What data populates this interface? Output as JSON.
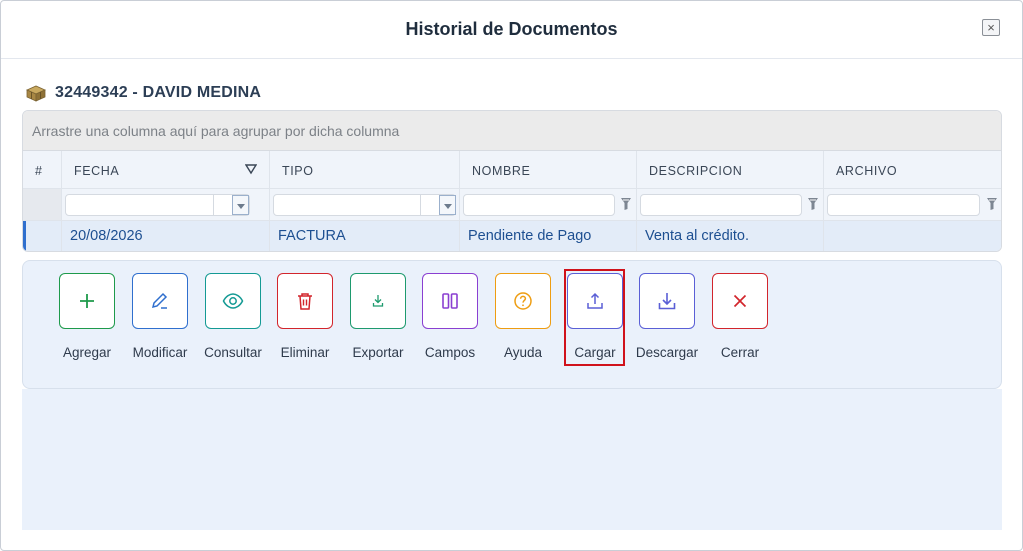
{
  "dialog": {
    "title": "Historial de Documentos",
    "close_label": "×"
  },
  "client": {
    "icon": "boxes-icon",
    "name": "32449342 - DAVID MEDINA"
  },
  "grid": {
    "group_hint": "Arrastre una columna aquí para agrupar por dicha columna",
    "columns": [
      "#",
      "FECHA",
      "TIPO",
      "NOMBRE",
      "DESCRIPCION",
      "ARCHIVO"
    ],
    "rows": [
      {
        "fecha": "20/08/2026",
        "tipo": "FACTURA",
        "nombre": "Pendiente de Pago",
        "descripcion": "Venta al crédito.",
        "archivo": ""
      }
    ]
  },
  "toolbar": {
    "buttons": [
      {
        "label": "Agregar",
        "icon": "plus-icon",
        "color": "#1e9a4b"
      },
      {
        "label": "Modificar",
        "icon": "pencil-icon",
        "color": "#2f6fce"
      },
      {
        "label": "Consultar",
        "icon": "eye-icon",
        "color": "#149a94"
      },
      {
        "label": "Eliminar",
        "icon": "trash-icon",
        "color": "#d2252c"
      },
      {
        "label": "Exportar",
        "icon": "export-icon",
        "color": "#1e9a6e"
      },
      {
        "label": "Campos",
        "icon": "columns-icon",
        "color": "#8a3fd1"
      },
      {
        "label": "Ayuda",
        "icon": "help-icon",
        "color": "#ee9d12"
      },
      {
        "label": "Cargar",
        "icon": "upload-icon",
        "color": "#5a5fd6"
      },
      {
        "label": "Descargar",
        "icon": "download-icon",
        "color": "#5a5fd6"
      },
      {
        "label": "Cerrar",
        "icon": "close-icon",
        "color": "#d2252c"
      }
    ],
    "highlighted": "Cargar"
  }
}
